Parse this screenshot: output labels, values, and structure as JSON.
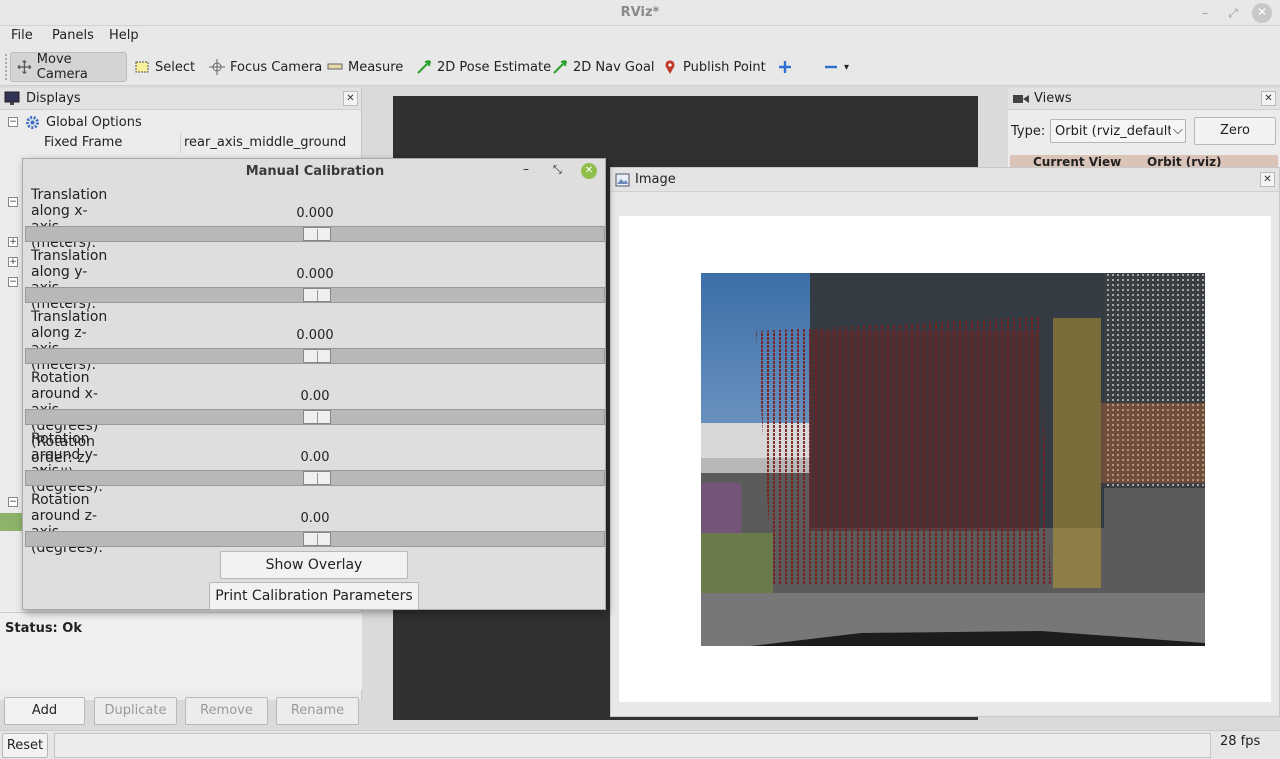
{
  "window": {
    "title": "RViz*"
  },
  "menu": {
    "file": "File",
    "panels": "Panels",
    "help": "Help"
  },
  "toolbar": {
    "move_camera": "Move Camera",
    "select": "Select",
    "focus_camera": "Focus Camera",
    "measure": "Measure",
    "pose_estimate": "2D Pose Estimate",
    "nav_goal": "2D Nav Goal",
    "publish_point": "Publish Point"
  },
  "displays": {
    "title": "Displays",
    "global_options": "Global Options",
    "fixed_frame_label": "Fixed Frame",
    "fixed_frame_value": "rear_axis_middle_ground",
    "status": "Status: Ok",
    "buttons": {
      "add": "Add",
      "duplicate": "Duplicate",
      "remove": "Remove",
      "rename": "Rename"
    }
  },
  "views": {
    "title": "Views",
    "type_label": "Type:",
    "type_value": "Orbit (rviz_default_",
    "zero": "Zero",
    "current_view": "Current View",
    "current_view_value": "Orbit (rviz)"
  },
  "image_panel": {
    "title": "Image"
  },
  "calibration": {
    "title": "Manual Calibration",
    "params": [
      {
        "label": "Translation along x-axis (meters):",
        "value": "0.000"
      },
      {
        "label": "Translation along y-axis (meters):",
        "value": "0.000"
      },
      {
        "label": "Translation along z-axis (meters):",
        "value": "0.000"
      },
      {
        "label": "Rotation around x-axis (degrees) (Rotation order: z, y', x''):",
        "value": "0.00"
      },
      {
        "label": "Rotation around y-axis (degrees):",
        "value": "0.00"
      },
      {
        "label": "Rotation around z-axis (degrees):",
        "value": "0.00"
      }
    ],
    "show_overlay": "Show Overlay",
    "print_params": "Print Calibration Parameters"
  },
  "bottom": {
    "reset": "Reset",
    "fps": "28 fps"
  }
}
